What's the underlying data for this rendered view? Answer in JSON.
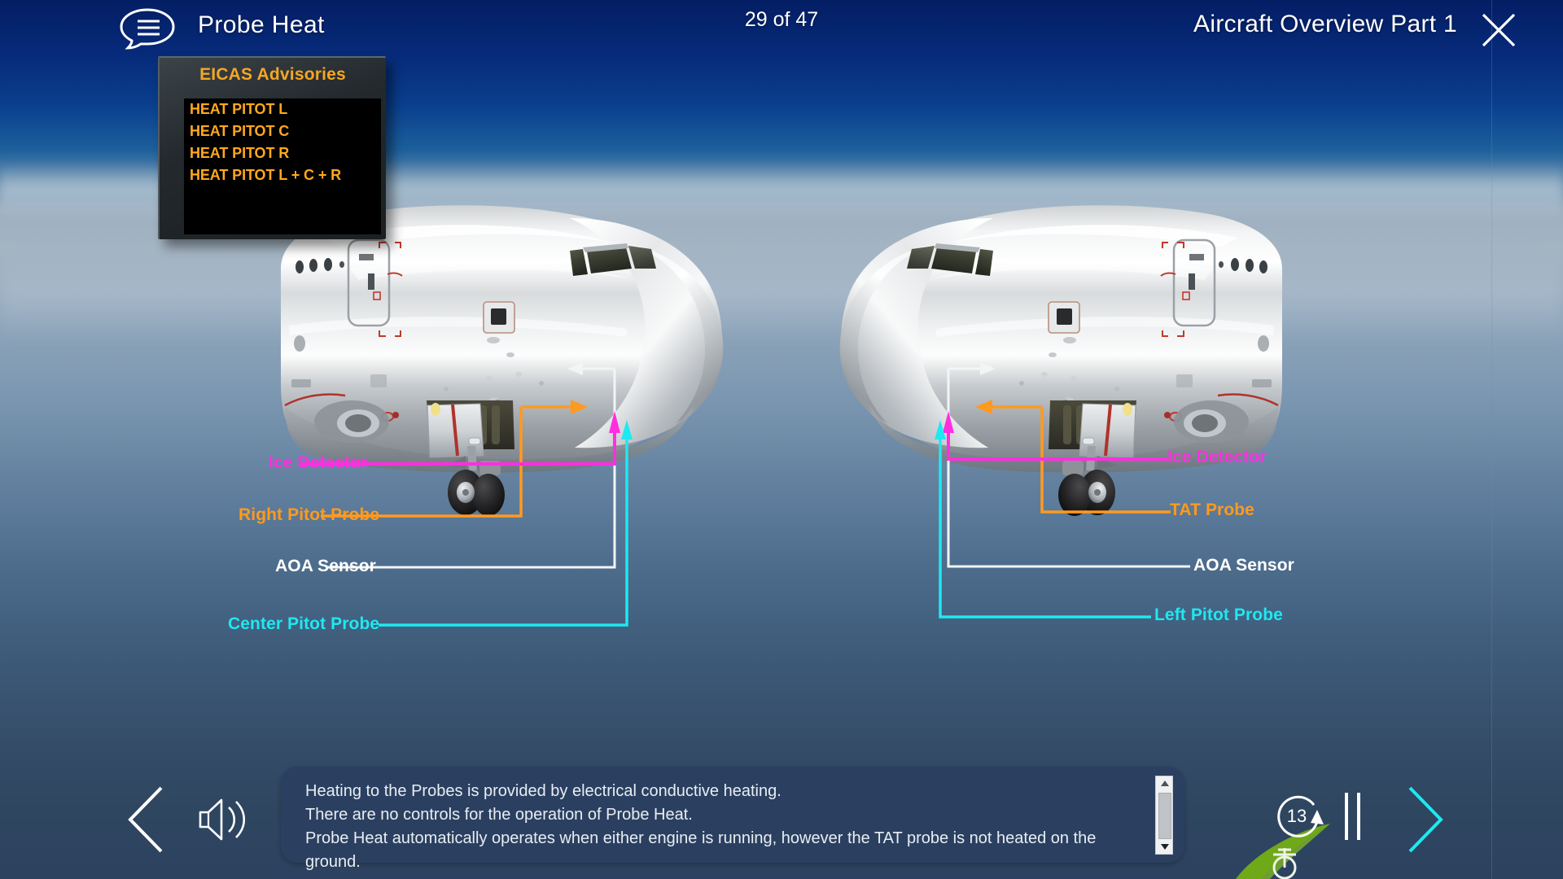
{
  "header": {
    "module_title": "Probe Heat",
    "page_counter": "29 of 47",
    "lesson_title": "Aircraft Overview Part 1",
    "notes_icon": "speech-bubble-icon",
    "close_icon": "close-icon"
  },
  "eicas": {
    "title": "EICAS Advisories",
    "messages": [
      "HEAT PITOT L",
      "HEAT PITOT C",
      "HEAT PITOT R",
      "HEAT PITOT L + C + R"
    ]
  },
  "callouts": {
    "left_view": [
      {
        "label": "Ice Detector",
        "color": "#ff2fe0"
      },
      {
        "label": "Right Pitot Probe",
        "color": "#ff9a1f"
      },
      {
        "label": "AOA Sensor",
        "color": "#ffffff"
      },
      {
        "label": "Center Pitot Probe",
        "color": "#1fe8f0"
      }
    ],
    "right_view": [
      {
        "label": "Ice Detector",
        "color": "#ff2fe0"
      },
      {
        "label": "TAT Probe",
        "color": "#ff9a1f"
      },
      {
        "label": "AOA Sensor",
        "color": "#ffffff"
      },
      {
        "label": "Left Pitot Probe",
        "color": "#1fe8f0"
      }
    ]
  },
  "narration": {
    "line1": "Heating to the Probes is provided by electrical conductive heating.",
    "line2": "There are no controls for the operation of Probe Heat.",
    "line3": "Probe Heat automatically operates when either engine is running, however the TAT probe is not heated on the ground."
  },
  "controls": {
    "previous_icon": "chevron-left-icon",
    "audio_icon": "speaker-icon",
    "replay_seconds": "13",
    "replay_icon": "replay-icon",
    "pause_icon": "pause-icon",
    "next_icon": "chevron-right-icon",
    "scroll_up_icon": "scroll-up-arrow-icon",
    "scroll_down_icon": "scroll-down-arrow-icon"
  },
  "colors": {
    "accent_cyan": "#1fe8f0",
    "accent_orange": "#ff9a1f",
    "accent_magenta": "#ff2fe0",
    "eicas_amber": "#ffa81e",
    "panel_blue": "#2b4060",
    "tail_green": "#6fa818"
  }
}
